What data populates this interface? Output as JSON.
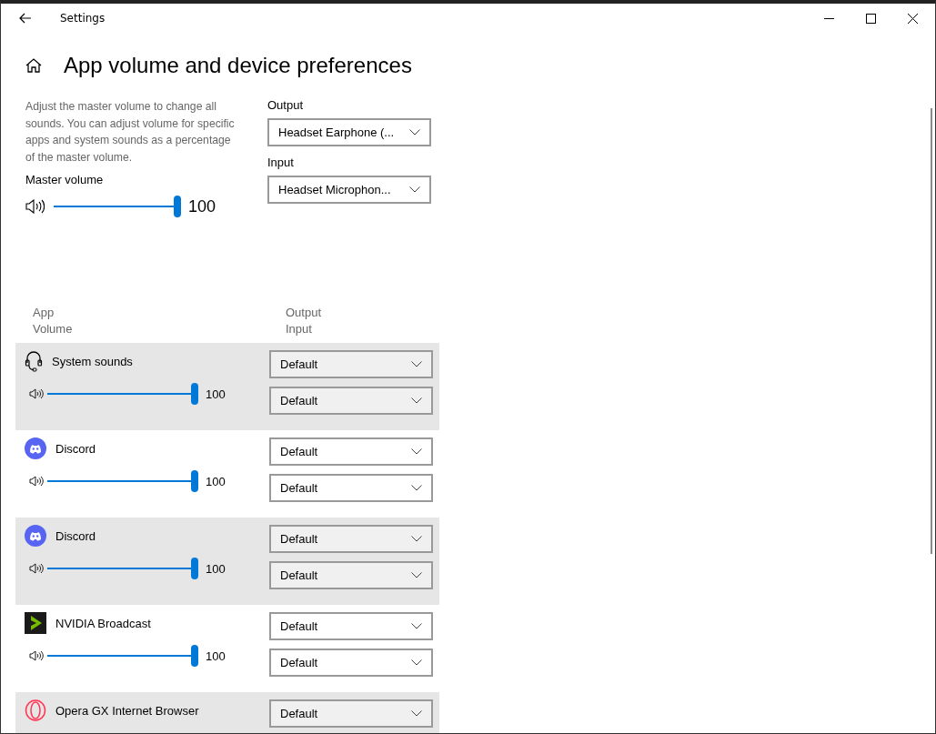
{
  "window": {
    "title": "Settings"
  },
  "page": {
    "title": "App volume and device preferences"
  },
  "master": {
    "description": "Adjust the master volume to change all sounds. You can adjust volume for specific apps and system sounds as a percentage of the master volume.",
    "label": "Master volume",
    "level": 1,
    "reading": "100"
  },
  "devices": [
    {
      "label": "Output",
      "value": "Headset Earphone (..."
    },
    {
      "label": "Input",
      "value": "Headset Microphon..."
    }
  ],
  "columns": {
    "app": "App",
    "volume": "Volume",
    "output": "Output",
    "input": "Input"
  },
  "apps": [
    {
      "kind": "headset",
      "name": "System sounds",
      "level": 1,
      "reading": "100",
      "output": "Default",
      "input": "Default"
    },
    {
      "kind": "discord",
      "name": "Discord",
      "level": 1,
      "reading": "100",
      "output": "Default",
      "input": "Default"
    },
    {
      "kind": "discord",
      "name": "Discord",
      "level": 1,
      "reading": "100",
      "output": "Default",
      "input": "Default"
    },
    {
      "kind": "nvidia",
      "name": "NVIDIA Broadcast",
      "level": 1,
      "reading": "100",
      "output": "Default",
      "input": "Default"
    },
    {
      "kind": "opera",
      "name": "Opera GX Internet Browser",
      "output": "Default"
    }
  ]
}
